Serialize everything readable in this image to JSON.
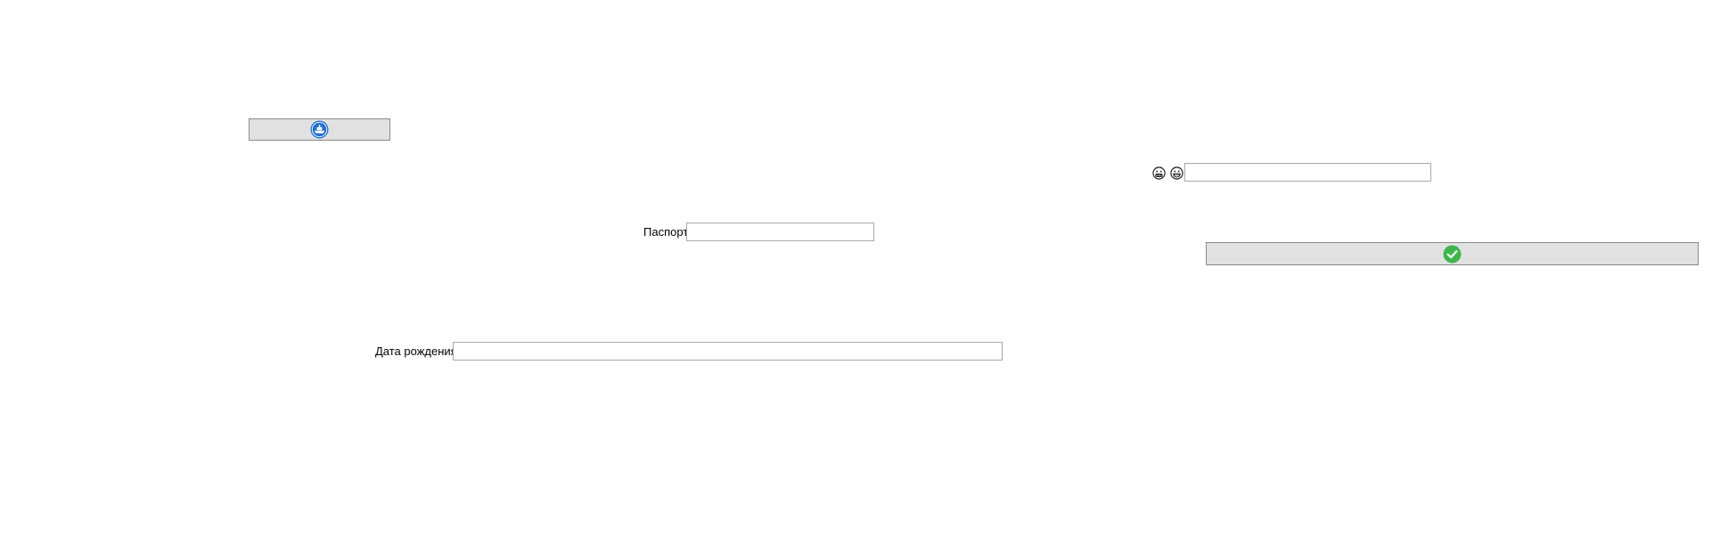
{
  "top_left_button": {
    "icon": "ship-badge-icon",
    "accent_color": "#1f6fd0"
  },
  "right_group": {
    "emoji_icons": [
      "grimacing-face-icon",
      "grinning-face-icon"
    ],
    "input_value": "",
    "input_placeholder": ""
  },
  "passport": {
    "label": "Паспорт",
    "value": "",
    "placeholder": ""
  },
  "confirm_button": {
    "icon": "check-circle-icon",
    "accent_color": "#3db54a"
  },
  "birth_date": {
    "label": "Дата рождения",
    "value": "",
    "placeholder": ""
  }
}
